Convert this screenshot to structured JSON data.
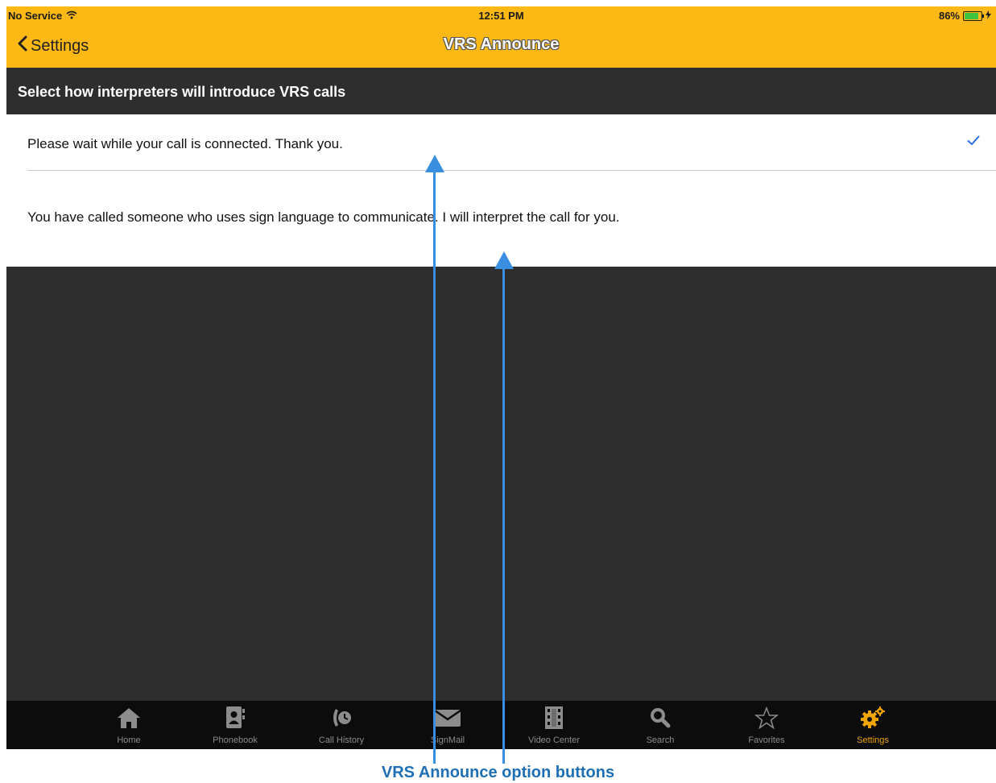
{
  "status_bar": {
    "carrier": "No Service",
    "time": "12:51 PM",
    "battery_percent": "86%",
    "battery_level": 0.86,
    "wifi_icon": "wifi-icon",
    "charging_icon": "charging-bolt-icon"
  },
  "nav": {
    "back_label": "Settings",
    "title": "VRS Announce"
  },
  "section": {
    "header": "Select how interpreters will introduce VRS calls"
  },
  "options": [
    {
      "label": "Please wait while your call is connected. Thank you.",
      "selected": true
    },
    {
      "label": "You have called someone who uses sign language to communicate. I will interpret the call for you.",
      "selected": false
    }
  ],
  "tabs": [
    {
      "label": "Home",
      "icon": "home-icon",
      "active": false
    },
    {
      "label": "Phonebook",
      "icon": "phonebook-icon",
      "active": false
    },
    {
      "label": "Call History",
      "icon": "call-history-icon",
      "active": false
    },
    {
      "label": "SignMail",
      "icon": "signmail-icon",
      "active": false
    },
    {
      "label": "Video Center",
      "icon": "video-center-icon",
      "active": false
    },
    {
      "label": "Search",
      "icon": "search-icon",
      "active": false
    },
    {
      "label": "Favorites",
      "icon": "favorites-star-icon",
      "active": false
    },
    {
      "label": "Settings",
      "icon": "settings-gear-icon",
      "active": true
    }
  ],
  "annotation": {
    "caption": "VRS Announce option buttons"
  },
  "colors": {
    "brand_yellow": "#fcb815",
    "check_blue": "#2a6fe0",
    "callout_blue": "#3b8fe0",
    "active_tab": "#f0a400"
  }
}
